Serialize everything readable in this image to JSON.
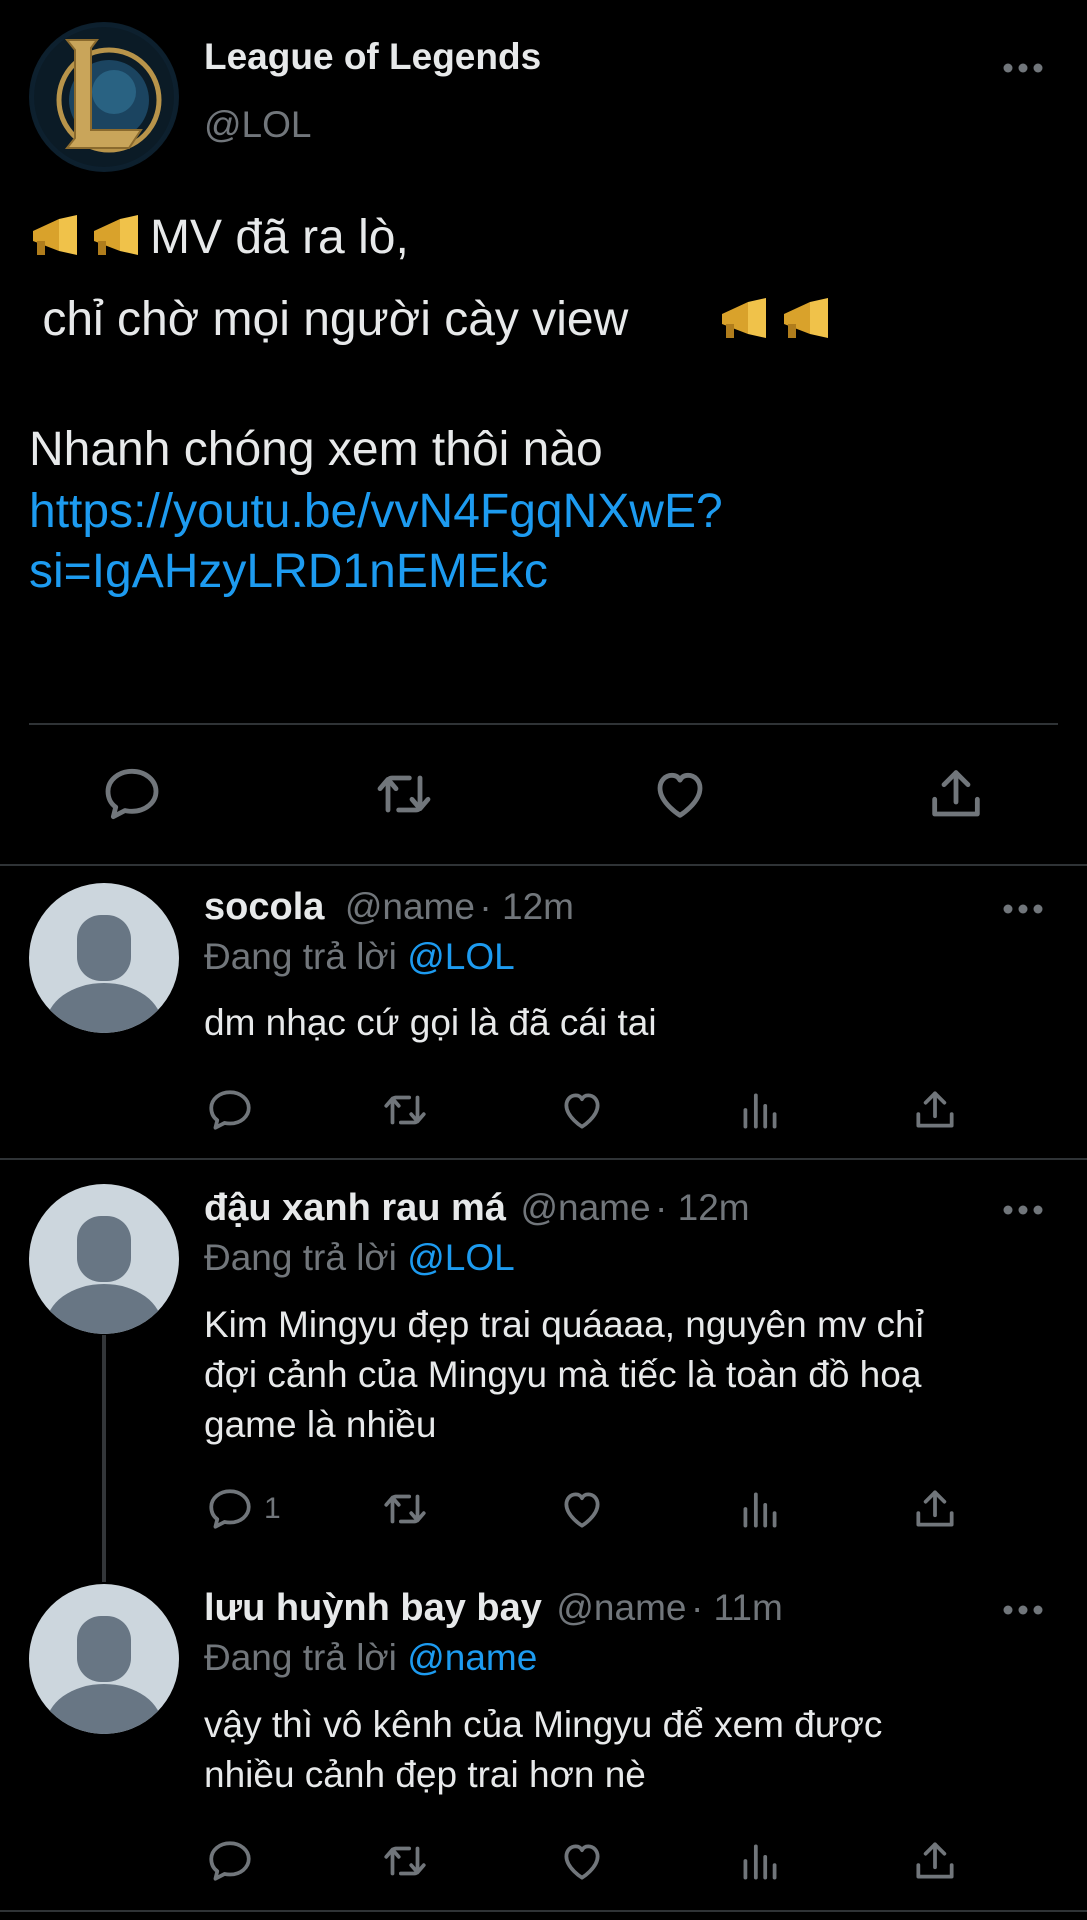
{
  "main_tweet": {
    "author": {
      "name": "League of Legends",
      "handle": "@LOL"
    },
    "line1_text": "MV đã ra lò,",
    "line2_text": " chỉ chờ mọi người cày view ",
    "line3_text": "Nhanh chóng xem thôi nào",
    "link_line1": "https://youtu.be/vvN4FgqNXwE?",
    "link_line2": "si=IgAHzyLRD1nEMEkc",
    "actions": [
      "reply-icon",
      "retweet-icon",
      "like-icon",
      "share-icon"
    ]
  },
  "replies": [
    {
      "name": "socola",
      "handle": "@name",
      "time": "· 12m",
      "replying_label": "Đang trả lời",
      "mention": "@LOL",
      "text": "dm nhạc cứ gọi là đã cái tai",
      "reply_count": ""
    },
    {
      "name": "đậu xanh rau má",
      "handle": "@name",
      "time": "· 12m",
      "replying_label": "Đang trả lời",
      "mention": "@LOL",
      "text_line1": "Kim Mingyu đẹp trai quáaaa, nguyên mv chỉ",
      "text_line2": "đợi cảnh của Mingyu mà tiếc là toàn đồ hoạ",
      "text_line3": "game là nhiều",
      "reply_count": "1"
    },
    {
      "name": "lưu huỳnh bay bay",
      "handle": "@name",
      "time": "· 11m",
      "replying_label": "Đang trả lời",
      "mention": "@name",
      "text_line1": "vậy thì vô kênh của Mingyu để xem được",
      "text_line2": "nhiều cảnh đẹp trai hơn nè",
      "reply_count": ""
    }
  ],
  "colors": {
    "background": "#000000",
    "text": "#e7e9ea",
    "secondary": "#71767b",
    "link": "#1d9bf0",
    "divider": "#2f3336"
  }
}
